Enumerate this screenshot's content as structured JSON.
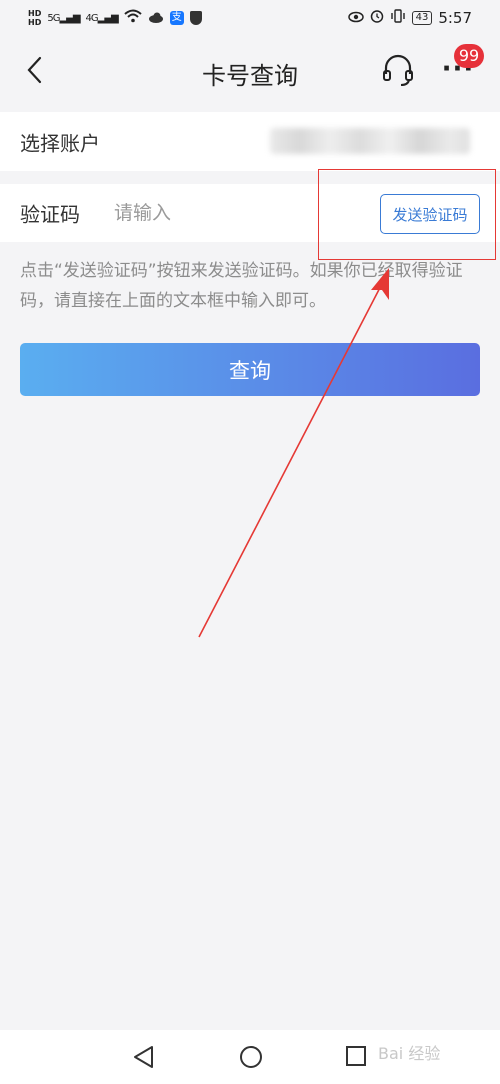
{
  "status_bar": {
    "hd1": "HD",
    "hd2": "HD",
    "net1": "5G",
    "net2": "4G",
    "alipay_glyph": "支",
    "battery": "43",
    "time": "5:57"
  },
  "nav": {
    "title": "卡号查询",
    "badge": "99",
    "more": "···"
  },
  "account_row": {
    "label": "选择账户"
  },
  "code_row": {
    "label": "验证码",
    "placeholder": "请输入",
    "send_button": "发送验证码"
  },
  "hint": "点击“发送验证码”按钮来发送验证码。如果你已经取得验证码，请直接在上面的文本框中输入即可。",
  "query_button": "查询",
  "watermark": "Bai 经验",
  "colors": {
    "accent": "#3a7bd5",
    "button_gradient_start": "#5aaef0",
    "button_gradient_end": "#5a6ee0",
    "badge": "#e6313a",
    "annotation": "#e53935"
  },
  "icons": [
    "signal-icon",
    "wifi-icon",
    "cloud-icon",
    "alipay-icon",
    "shield-icon",
    "eye-icon",
    "alarm-icon",
    "vibrate-icon",
    "battery-icon",
    "back-icon",
    "headset-icon",
    "more-icon",
    "nav-back-icon",
    "nav-home-icon",
    "nav-recent-icon"
  ]
}
